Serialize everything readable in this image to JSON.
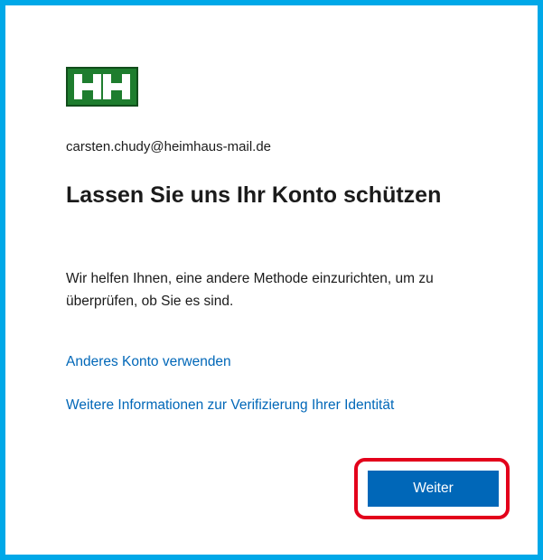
{
  "colors": {
    "frame_border": "#00a8e8",
    "logo_green": "#1e7d2e",
    "link_blue": "#0067b8",
    "button_blue": "#0067b8",
    "highlight_red": "#e3001b"
  },
  "logo": {
    "text": "HH",
    "icon": "company-logo"
  },
  "account": {
    "email": "carsten.chudy@heimhaus-mail.de"
  },
  "main": {
    "title": "Lassen Sie uns Ihr Konto schützen",
    "description": "Wir helfen Ihnen, eine andere Methode einzurichten, um zu überprüfen, ob Sie es sind."
  },
  "links": {
    "other_account": "Anderes Konto verwenden",
    "more_info": "Weitere Informationen zur Verifizierung Ihrer Identität"
  },
  "actions": {
    "next_label": "Weiter"
  }
}
